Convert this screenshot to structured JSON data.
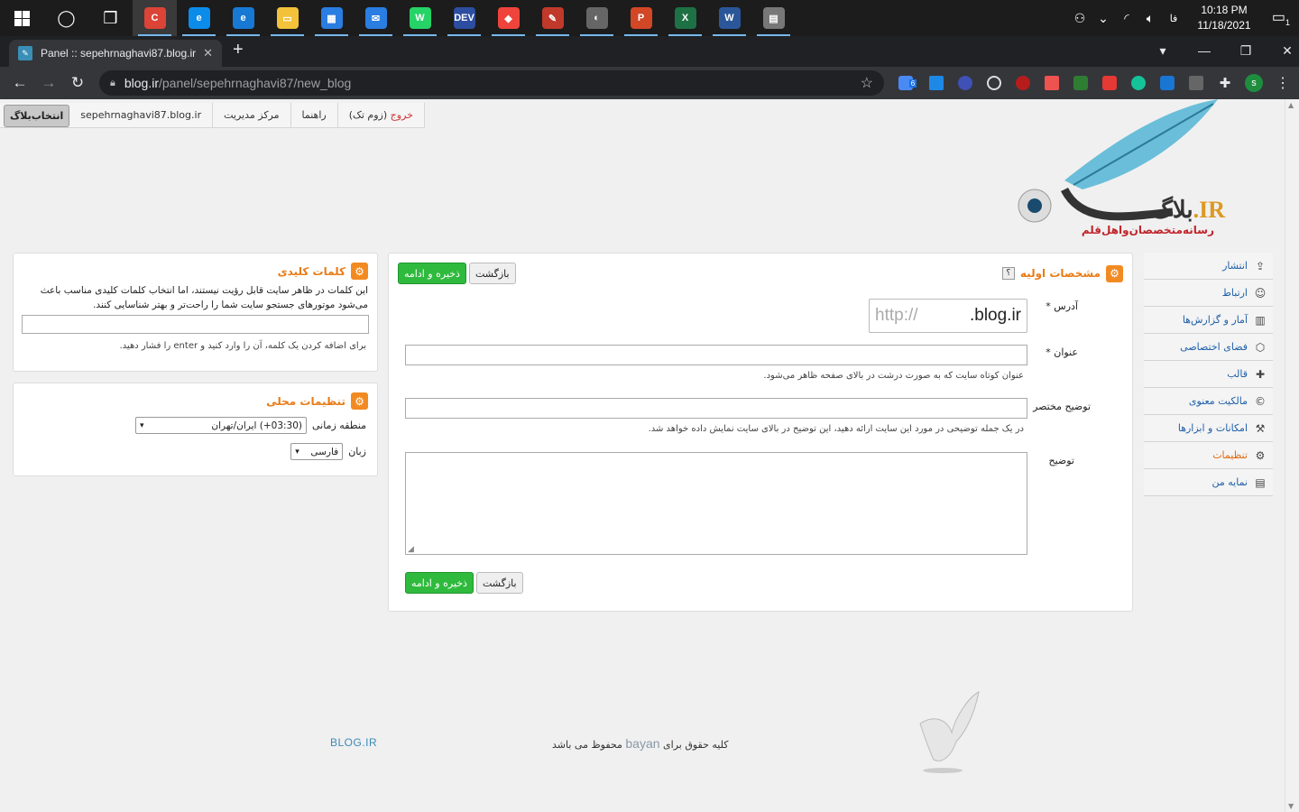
{
  "taskbar": {
    "apps": [
      {
        "name": "chrome",
        "label": "C",
        "color": "#db4437"
      },
      {
        "name": "edge",
        "label": "e",
        "color": "#0c8ce9"
      },
      {
        "name": "edge-legacy",
        "label": "e",
        "color": "#1779d4"
      },
      {
        "name": "file-explorer",
        "label": "▭",
        "color": "#f3c13a"
      },
      {
        "name": "store",
        "label": "▦",
        "color": "#2a7de1"
      },
      {
        "name": "mail",
        "label": "✉",
        "color": "#2a7de1"
      },
      {
        "name": "whatsapp",
        "label": "W",
        "color": "#25d366"
      },
      {
        "name": "dev",
        "label": "DEV",
        "color": "#2c4da0"
      },
      {
        "name": "anydesk",
        "label": "◆",
        "color": "#ef443b"
      },
      {
        "name": "paint",
        "label": "✎",
        "color": "#c0392b"
      },
      {
        "name": "app-moon",
        "label": "◐",
        "color": "#666666"
      },
      {
        "name": "powerpoint",
        "label": "P",
        "color": "#d24726"
      },
      {
        "name": "excel",
        "label": "X",
        "color": "#1e7145"
      },
      {
        "name": "word",
        "label": "W",
        "color": "#2b579a"
      },
      {
        "name": "app-misc",
        "label": "▤",
        "color": "#777777"
      }
    ],
    "lang": "فا",
    "time": "10:18 PM",
    "date": "11/18/2021",
    "notif_count": "1"
  },
  "browser": {
    "tab_title": "Panel :: sepehrnaghavi87.blog.ir",
    "url_host": "blog.ir",
    "url_path": "/panel/sepehrnaghavi87/new_blog",
    "ext_badge": "6",
    "profile": "s"
  },
  "topnav": {
    "select_blog": "انتخاب‌بلاگ",
    "blog_name": "sepehrnaghavi87.blog.ir",
    "admin_center": "مرکز مدیریت",
    "help": "راهنما",
    "logout": "خروج",
    "logout_suffix": "(زوم تک)"
  },
  "logo": {
    "brand": "بلاگ",
    "ir": ".IR",
    "tagline": "رسانه‌متخصصان‌واهل‌قلم"
  },
  "sidebar": [
    {
      "label": "انتشار",
      "icon": "⇪",
      "active": false
    },
    {
      "label": "ارتباط",
      "icon": "☺",
      "active": false
    },
    {
      "label": "آمار و گزارش‌ها",
      "icon": "▥",
      "active": false
    },
    {
      "label": "فضای اختصاصی",
      "icon": "⬡",
      "active": false
    },
    {
      "label": "قالب",
      "icon": "✚",
      "active": false
    },
    {
      "label": "مالکیت معنوی",
      "icon": "©",
      "active": false
    },
    {
      "label": "امکانات و ابزارها",
      "icon": "⚒",
      "active": false
    },
    {
      "label": "تنظیمات",
      "icon": "⚙",
      "active": true
    },
    {
      "label": "نمایه من",
      "icon": "▤",
      "active": false
    }
  ],
  "main": {
    "title": "مشخصات اولیه",
    "help": "؟",
    "save": "ذخیره و ادامه",
    "back": "بازگشت",
    "address_label": "آدرس *",
    "address_prefix": "http://",
    "address_suffix": ".blog.ir",
    "title_label": "عنوان *",
    "title_hint": "عنوان کوتاه سایت که به صورت درشت در بالای صفحه ظاهر می‌شود.",
    "short_desc_label": "توضیح مختصر",
    "short_desc_hint": "در یک جمله توضیحی در مورد این سایت ارائه دهید، این توضیح در بالای سایت نمایش داده خواهد شد.",
    "desc_label": "توضیح"
  },
  "keywords": {
    "title": "کلمات کلیدی",
    "desc": "این کلمات در ظاهر سایت قابل رؤیت نیستند، اما انتخاب کلمات کلیدی مناسب باعث می‌شود موتورهای جستجو سایت شما را راحت‌تر و بهتر شناسایی کنند.",
    "hint": "برای اضافه کردن یک کلمه، آن را وارد کنید و enter را فشار دهید."
  },
  "locale": {
    "title": "تنظیمات محلی",
    "tz_label": "منطقه زمانی",
    "tz_value": "(03:30+) ایران/تهران",
    "lang_label": "زبان",
    "lang_value": "فارسی"
  },
  "footer": {
    "rights_pre": "کلیه حقوق برای",
    "bayan": "bayan",
    "rights_post": "محفوظ می باشد",
    "brand": "BLOG.IR"
  }
}
